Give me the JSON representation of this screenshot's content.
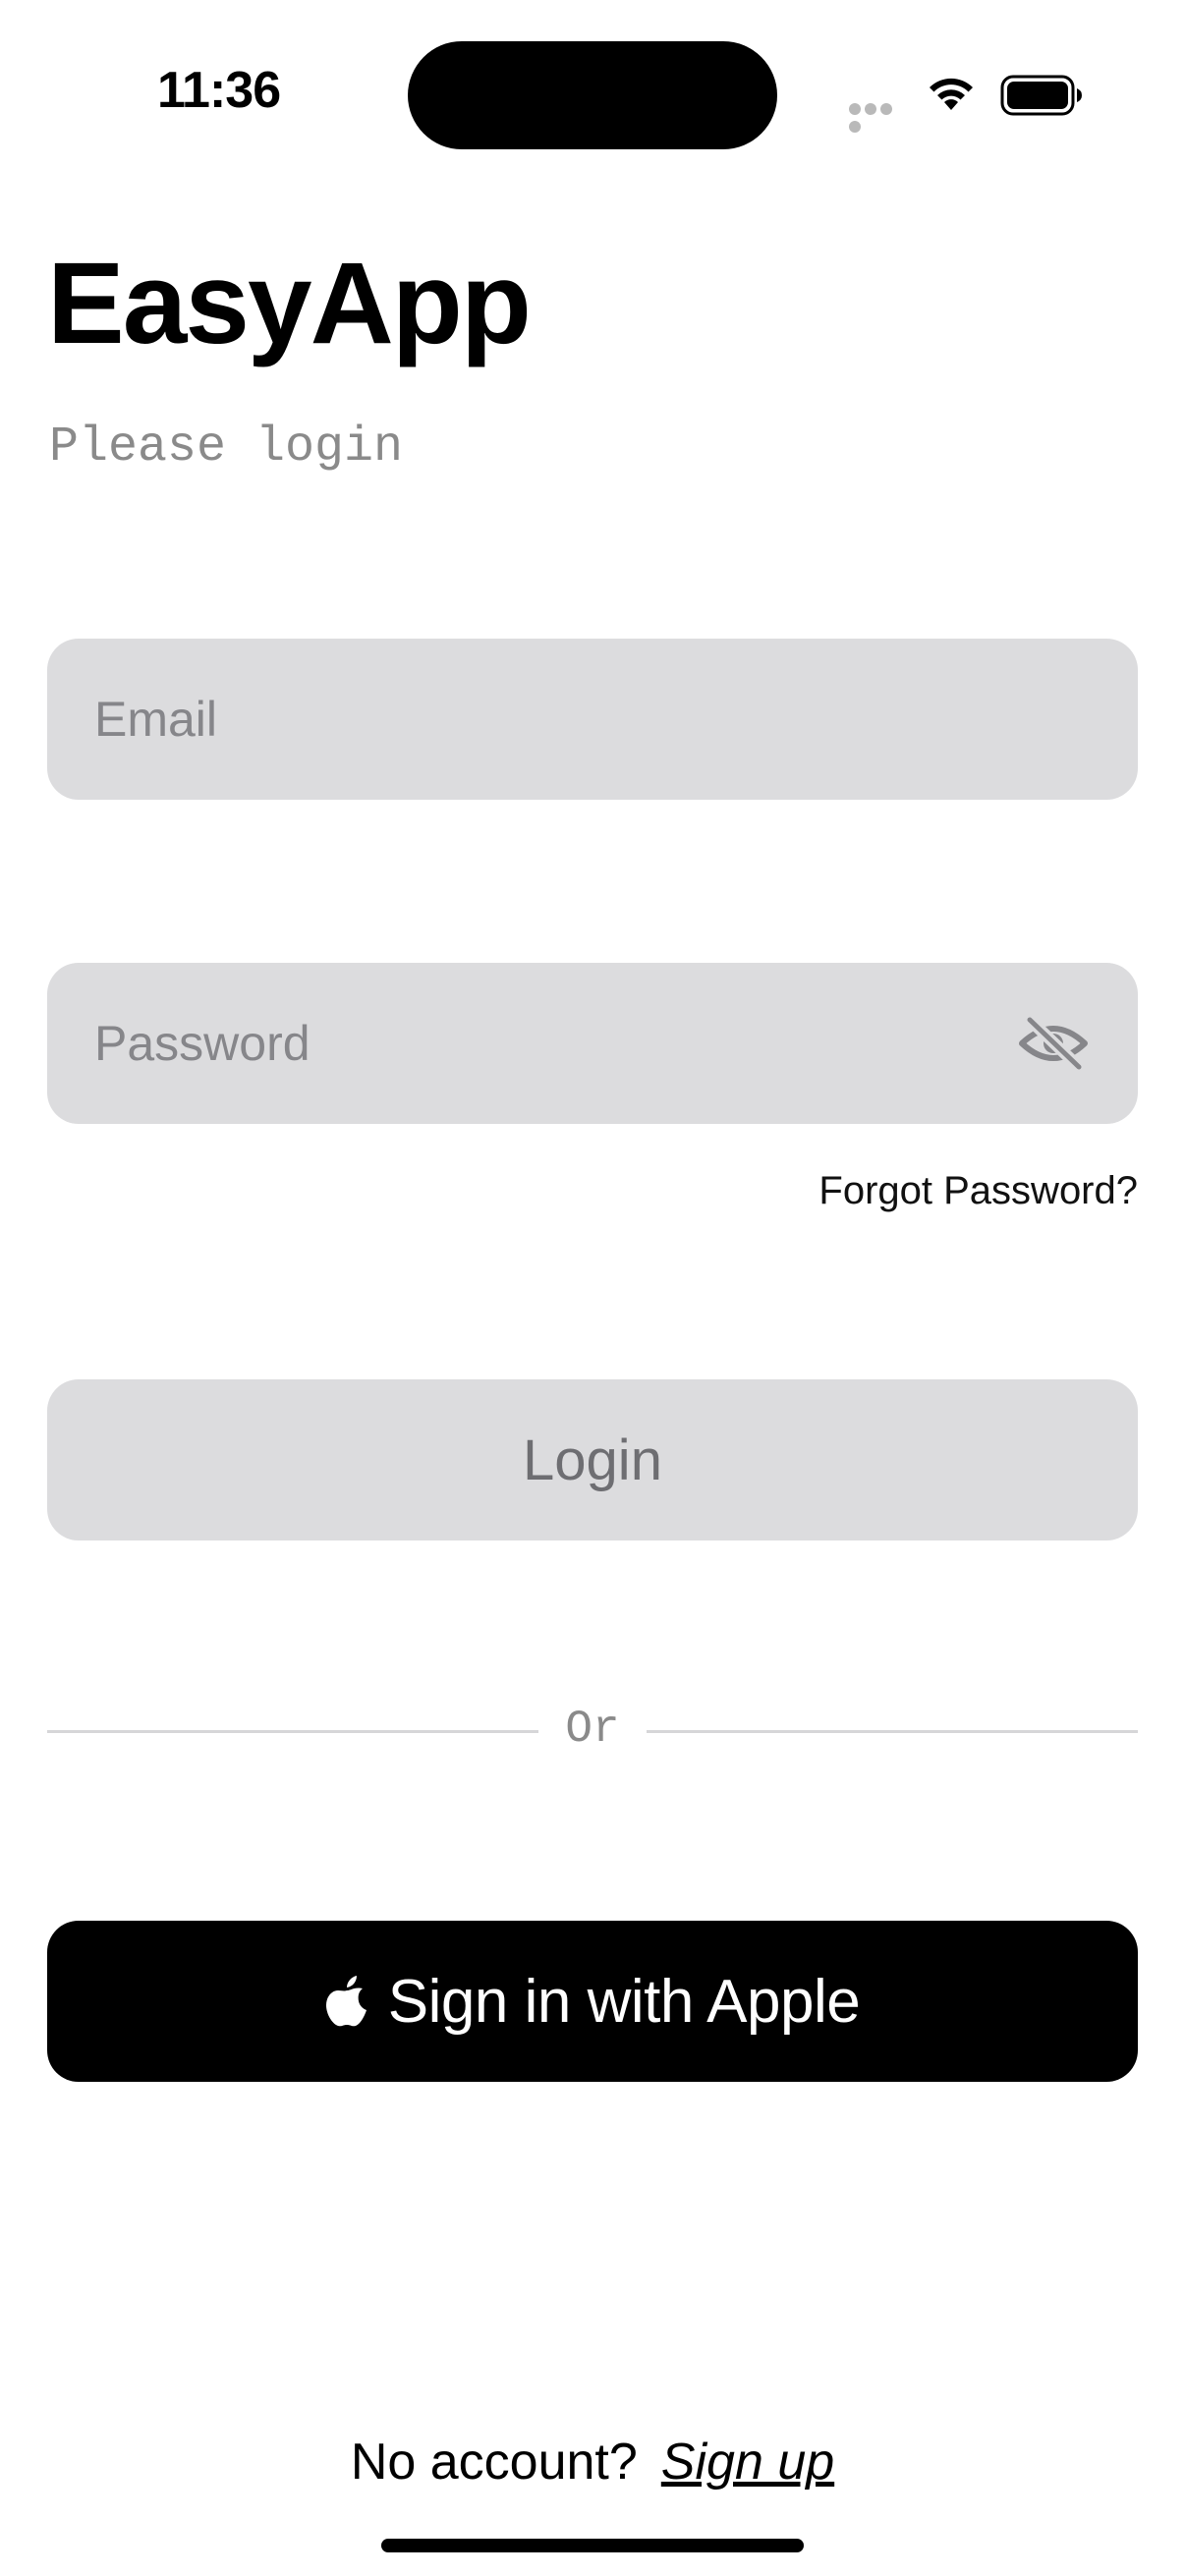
{
  "status_bar": {
    "time": "11:36"
  },
  "header": {
    "title": "EasyApp",
    "subtitle": "Please login"
  },
  "form": {
    "email_placeholder": "Email",
    "email_value": "",
    "password_placeholder": "Password",
    "password_value": "",
    "password_toggle_icon": "eye-slash-icon",
    "forgot_password_label": "Forgot Password?",
    "login_label": "Login"
  },
  "divider": {
    "label": "Or"
  },
  "apple_signin": {
    "icon": "apple-logo-icon",
    "label": "Sign in with Apple"
  },
  "footer": {
    "prompt": "No account?",
    "signup_label": "Sign up"
  },
  "colors": {
    "field_background": "#dcdcde",
    "placeholder_text": "#86868a",
    "subtitle_text": "#8a8a8a",
    "apple_button_background": "#000000",
    "apple_button_text": "#ffffff"
  }
}
